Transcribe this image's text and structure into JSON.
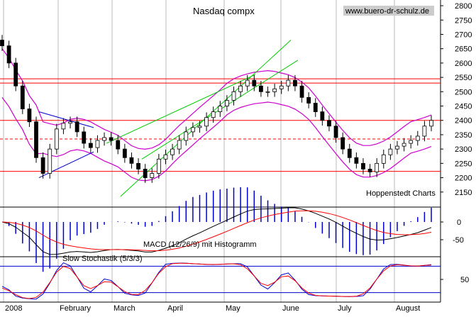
{
  "chart_data": {
    "type": "candlestick",
    "title": "Nasdaq compx",
    "watermark": "www.buero-dr-schulz.de",
    "source_note": "Hoppenstedt Charts",
    "x_months": [
      "2008",
      "February",
      "March",
      "April",
      "May",
      "June",
      "July",
      "August"
    ],
    "y_ticks": [
      2150,
      2200,
      2250,
      2300,
      2350,
      2400,
      2450,
      2500,
      2550,
      2600,
      2650,
      2700,
      2750,
      2800
    ],
    "ylim": [
      2100,
      2810
    ],
    "horizontal_lines": [
      {
        "value": 2545,
        "style": "solid",
        "color": "#ff0000"
      },
      {
        "value": 2530,
        "style": "solid",
        "color": "#ff0000"
      },
      {
        "value": 2400,
        "style": "solid",
        "color": "#ff0000"
      },
      {
        "value": 2335,
        "style": "dashed",
        "color": "#ff0000"
      },
      {
        "value": 2222,
        "style": "solid",
        "color": "#ff0000"
      }
    ],
    "close_series": [
      2660,
      2600,
      2520,
      2440,
      2395,
      2270,
      2215,
      2300,
      2370,
      2390,
      2395,
      2360,
      2320,
      2305,
      2330,
      2340,
      2330,
      2300,
      2270,
      2250,
      2230,
      2200,
      2215,
      2265,
      2280,
      2300,
      2330,
      2360,
      2375,
      2380,
      2410,
      2430,
      2450,
      2470,
      2500,
      2520,
      2540,
      2520,
      2500,
      2500,
      2510,
      2520,
      2540,
      2520,
      2480,
      2460,
      2430,
      2400,
      2380,
      2340,
      2300,
      2270,
      2250,
      2230,
      2220,
      2250,
      2280,
      2300,
      2310,
      2320,
      2330,
      2345,
      2380,
      2400
    ],
    "macd": {
      "label": "MACD (12/26/9) mit Histogramm",
      "y_ticks": [
        0,
        -50
      ]
    },
    "stochastic": {
      "label": "Slow Stochastik (5/3/3)",
      "y_ticks": [
        50
      ]
    },
    "colors": {
      "bollinger": "#cc00cc",
      "trend_channel": "#00cc00",
      "wedge": "#0000cc",
      "signal": "#ff0000",
      "grid": "#bbbbbb",
      "histogram": "#0000cc"
    }
  }
}
